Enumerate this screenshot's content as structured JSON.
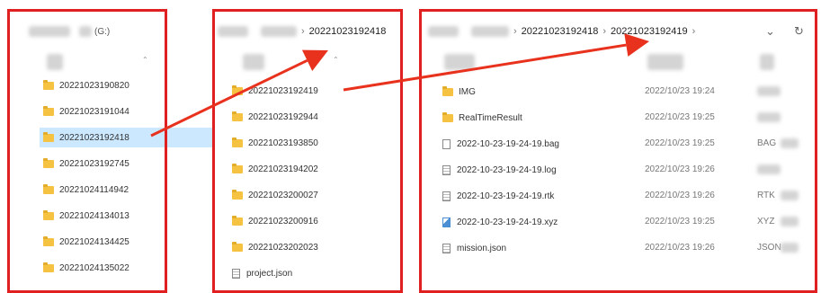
{
  "colors": {
    "frame": "#e02020",
    "arrow": "#e8321e",
    "selection": "#cce8ff",
    "folder": "#f5c242"
  },
  "left": {
    "path_tail": "(G:)",
    "folders": [
      {
        "name": "20221023190820",
        "selected": false
      },
      {
        "name": "20221023191044",
        "selected": false
      },
      {
        "name": "20221023192418",
        "selected": true
      },
      {
        "name": "20221023192745",
        "selected": false
      },
      {
        "name": "20221024114942",
        "selected": false
      },
      {
        "name": "20221024134013",
        "selected": false
      },
      {
        "name": "20221024134425",
        "selected": false
      },
      {
        "name": "20221024135022",
        "selected": false
      }
    ]
  },
  "middle": {
    "breadcrumb": "20221023192418",
    "items": [
      {
        "name": "20221023192419",
        "kind": "folder"
      },
      {
        "name": "20221023192944",
        "kind": "folder"
      },
      {
        "name": "20221023193850",
        "kind": "folder"
      },
      {
        "name": "20221023194202",
        "kind": "folder"
      },
      {
        "name": "20221023200027",
        "kind": "folder"
      },
      {
        "name": "20221023200916",
        "kind": "folder"
      },
      {
        "name": "20221023202023",
        "kind": "folder"
      },
      {
        "name": "project.json",
        "kind": "file"
      }
    ]
  },
  "right": {
    "breadcrumb": [
      "20221023192418",
      "20221023192419"
    ],
    "items": [
      {
        "name": "IMG",
        "kind": "folder",
        "date": "2022/10/23 19:24",
        "type": ""
      },
      {
        "name": "RealTimeResult",
        "kind": "folder",
        "date": "2022/10/23 19:25",
        "type": ""
      },
      {
        "name": "2022-10-23-19-24-19.bag",
        "kind": "file",
        "date": "2022/10/23 19:25",
        "type": "BAG"
      },
      {
        "name": "2022-10-23-19-24-19.log",
        "kind": "lines",
        "date": "2022/10/23 19:26",
        "type": ""
      },
      {
        "name": "2022-10-23-19-24-19.rtk",
        "kind": "lines",
        "date": "2022/10/23 19:26",
        "type": "RTK"
      },
      {
        "name": "2022-10-23-19-24-19.xyz",
        "kind": "xyz",
        "date": "2022/10/23 19:25",
        "type": "XYZ"
      },
      {
        "name": "mission.json",
        "kind": "lines",
        "date": "2022/10/23 19:26",
        "type": "JSON"
      }
    ]
  },
  "icons": {
    "dropdown": "chevron-down-icon",
    "refresh": "refresh-icon",
    "breadcrumb_chevron": "›",
    "dropdown_glyph": "⌄",
    "refresh_glyph": "↻",
    "sort_glyph": "⌃"
  }
}
